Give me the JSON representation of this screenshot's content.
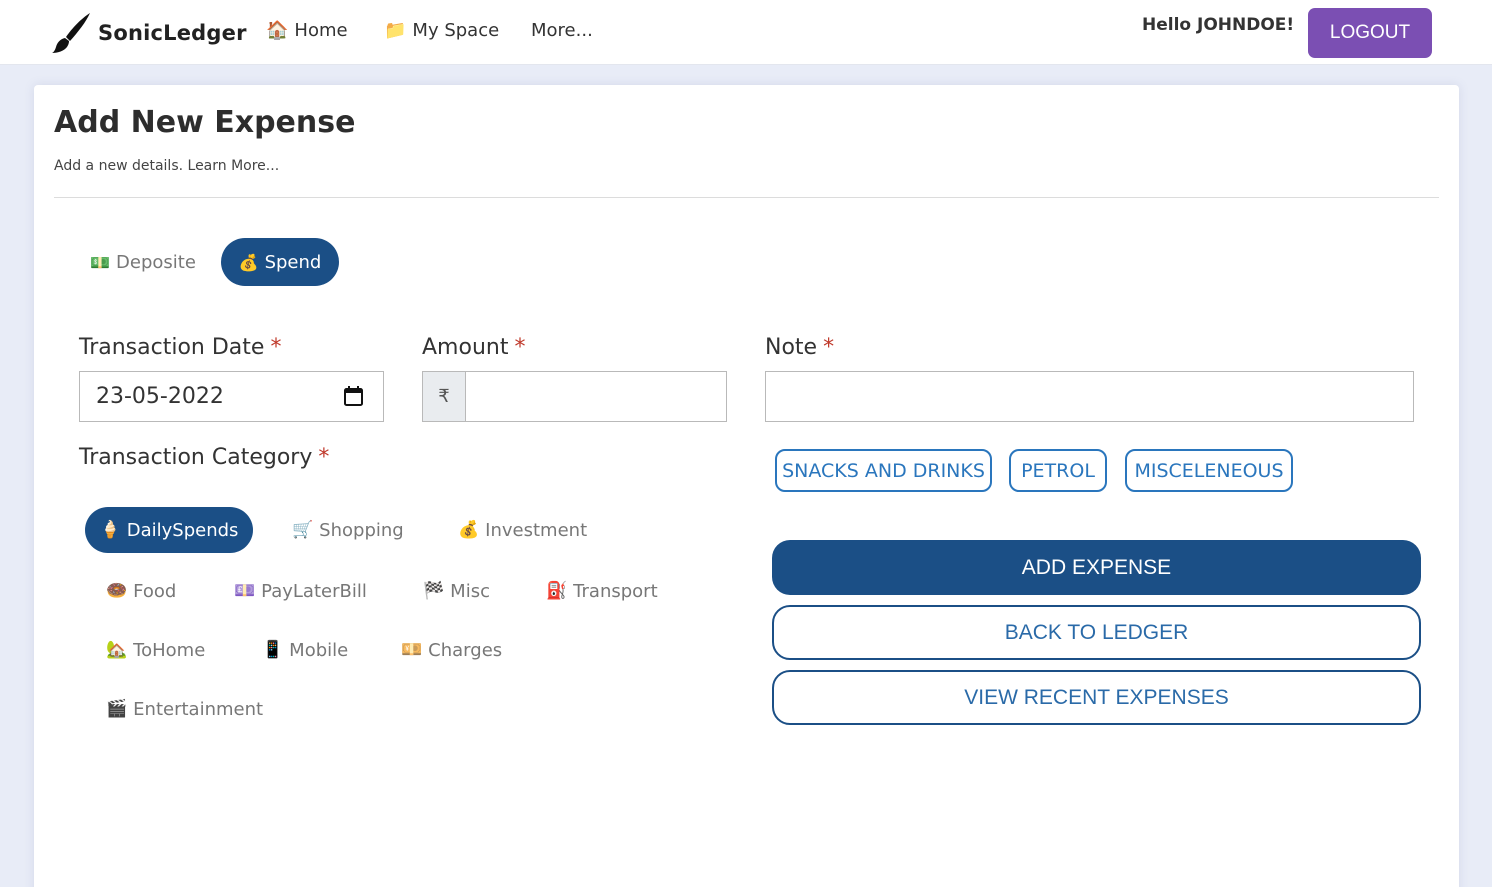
{
  "nav": {
    "brand": "SonicLedger",
    "links": [
      {
        "label": "Home",
        "icon": "🏠"
      },
      {
        "label": "My Space",
        "icon": "📁"
      },
      {
        "label": "More...",
        "icon": ""
      }
    ],
    "greeting": "Hello JOHNDOE!",
    "logout_label": "LOGOUT"
  },
  "page": {
    "title": "Add New Expense",
    "subtitle": "Add a new details. Learn More..."
  },
  "type_toggle": [
    {
      "label": "Deposite",
      "icon": "💵",
      "active": false
    },
    {
      "label": "Spend",
      "icon": "💰",
      "active": true
    }
  ],
  "form": {
    "date": {
      "label": "Transaction Date",
      "required": "*",
      "value": "23-05-2022"
    },
    "amount": {
      "label": "Amount",
      "required": "*",
      "currency": "₹",
      "value": ""
    },
    "note": {
      "label": "Note",
      "required": "*",
      "value": ""
    },
    "category": {
      "label": "Transaction Category",
      "required": "*"
    }
  },
  "note_suggestions": [
    "SNACKS AND DRINKS",
    "PETROL",
    "MISCELENEOUS"
  ],
  "categories": [
    {
      "label": "DailySpends",
      "icon": "🍦",
      "active": true
    },
    {
      "label": "Shopping",
      "icon": "🛒",
      "active": false
    },
    {
      "label": "Investment",
      "icon": "💰",
      "active": false
    },
    {
      "label": "Food",
      "icon": "🍩",
      "active": false
    },
    {
      "label": "PayLaterBill",
      "icon": "💷",
      "active": false
    },
    {
      "label": "Misc",
      "icon": "🏁",
      "active": false
    },
    {
      "label": "Transport",
      "icon": "⛽",
      "active": false
    },
    {
      "label": "ToHome",
      "icon": "🏡",
      "active": false
    },
    {
      "label": "Mobile",
      "icon": "📱",
      "active": false
    },
    {
      "label": "Charges",
      "icon": "💴",
      "active": false
    },
    {
      "label": "Entertainment",
      "icon": "🎬",
      "active": false
    }
  ],
  "actions": {
    "add": "ADD EXPENSE",
    "back": "BACK TO LEDGER",
    "recent": "VIEW RECENT EXPENSES"
  },
  "colors": {
    "primary": "#1b4f86",
    "logout": "#7b4fb3",
    "chip": "#2a76bd",
    "required": "#c0392b"
  }
}
